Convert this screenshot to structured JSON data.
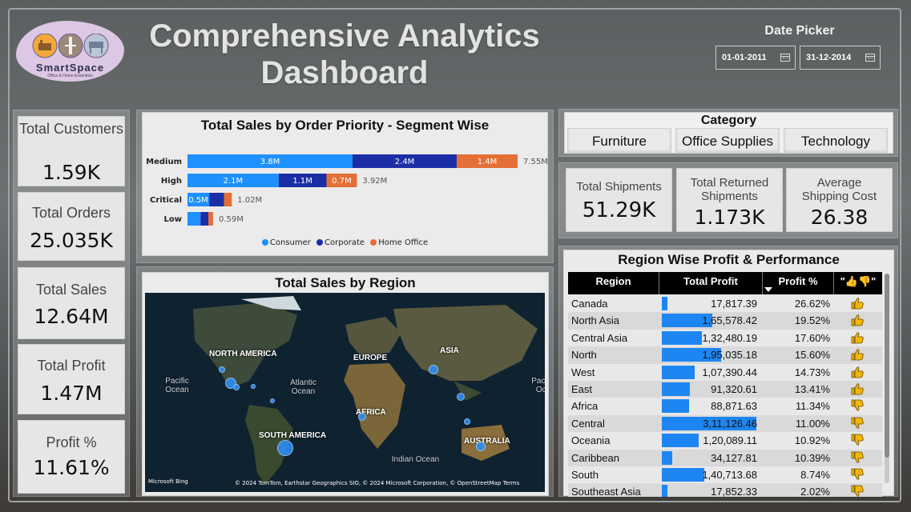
{
  "brand": {
    "name": "SmartSpace",
    "tagline": "Office & Home Essentials"
  },
  "title": "Comprehensive Analytics Dashboard",
  "date_picker": {
    "label": "Date Picker",
    "start": "01-01-2011",
    "end": "31-12-2014"
  },
  "kpis": [
    {
      "label": "Total Customers",
      "value": "1.59K"
    },
    {
      "label": "Total Orders",
      "value": "25.035K"
    },
    {
      "label": "Total Sales",
      "value": "12.64M"
    },
    {
      "label": "Total Profit",
      "value": "1.47M"
    },
    {
      "label": "Profit %",
      "value": "11.61%"
    }
  ],
  "category": {
    "title": "Category",
    "options": [
      "Furniture",
      "Office Supplies",
      "Technology"
    ]
  },
  "shipments": [
    {
      "label": "Total Shipments",
      "value": "51.29K"
    },
    {
      "label": "Total Returned Shipments",
      "value": "1.173K"
    },
    {
      "label": "Average Shipping Cost",
      "value": "26.38"
    }
  ],
  "colors": {
    "consumer": "#1e90ff",
    "corporate": "#1c2ea6",
    "home_office": "#e46f36",
    "bar_profit": "#1e86f2"
  },
  "chart_data": {
    "type": "bar",
    "orientation": "horizontal",
    "stacked": true,
    "title": "Total Sales by Order Priority - Segment Wise",
    "categories": [
      "Medium",
      "High",
      "Critical",
      "Low"
    ],
    "series": [
      {
        "name": "Consumer",
        "values": [
          3.8,
          2.1,
          0.5,
          0.3
        ],
        "labels": [
          "3.8M",
          "2.1M",
          "0.5M",
          ""
        ]
      },
      {
        "name": "Corporate",
        "values": [
          2.4,
          1.1,
          0.34,
          0.18
        ],
        "labels": [
          "2.4M",
          "1.1M",
          "",
          ""
        ]
      },
      {
        "name": "Home Office",
        "values": [
          1.4,
          0.7,
          0.18,
          0.11
        ],
        "labels": [
          "1.4M",
          "0.7M",
          "",
          ""
        ]
      }
    ],
    "totals": [
      "7.55M",
      "3.92M",
      "1.02M",
      "0.59M"
    ],
    "legend": "bottom",
    "grid": false
  },
  "map": {
    "title": "Total Sales by Region",
    "labels": [
      "NORTH AMERICA",
      "EUROPE",
      "ASIA",
      "AFRICA",
      "SOUTH AMERICA",
      "AUSTRALIA"
    ],
    "oceans": [
      "Pacific Ocean",
      "Atlantic Ocean",
      "Indian Ocean",
      "Pacific Oce"
    ],
    "attribution": "© 2024 TomTom, Earthstar Geographics SIO, © 2024 Microsoft Corporation, © OpenStreetMap  Terms",
    "provider": "Microsoft Bing"
  },
  "table": {
    "title": "Region Wise Profit & Performance",
    "headers": [
      "Region",
      "Total Profit",
      "Profit %",
      "\"👍👎\""
    ],
    "rows": [
      {
        "region": "Canada",
        "profit": "17,817.39",
        "pct": "26.62%",
        "profit_value": 17817.39,
        "icon": "thumbs-up"
      },
      {
        "region": "North Asia",
        "profit": "1,65,578.42",
        "pct": "19.52%",
        "profit_value": 165578.42,
        "icon": "thumbs-up"
      },
      {
        "region": "Central Asia",
        "profit": "1,32,480.19",
        "pct": "17.60%",
        "profit_value": 132480.19,
        "icon": "thumbs-up"
      },
      {
        "region": "North",
        "profit": "1,95,035.18",
        "pct": "15.60%",
        "profit_value": 195035.18,
        "icon": "thumbs-up"
      },
      {
        "region": "West",
        "profit": "1,07,390.44",
        "pct": "14.73%",
        "profit_value": 107390.44,
        "icon": "thumbs-up"
      },
      {
        "region": "East",
        "profit": "91,320.61",
        "pct": "13.41%",
        "profit_value": 91320.61,
        "icon": "thumbs-up"
      },
      {
        "region": "Africa",
        "profit": "88,871.63",
        "pct": "11.34%",
        "profit_value": 88871.63,
        "icon": "thumbs-down"
      },
      {
        "region": "Central",
        "profit": "3,11,126.46",
        "pct": "11.00%",
        "profit_value": 311126.46,
        "icon": "thumbs-down"
      },
      {
        "region": "Oceania",
        "profit": "1,20,089.11",
        "pct": "10.92%",
        "profit_value": 120089.11,
        "icon": "thumbs-down"
      },
      {
        "region": "Caribbean",
        "profit": "34,127.81",
        "pct": "10.39%",
        "profit_value": 34127.81,
        "icon": "thumbs-down"
      },
      {
        "region": "South",
        "profit": "1,40,713.68",
        "pct": "8.74%",
        "profit_value": 140713.68,
        "icon": "thumbs-down"
      },
      {
        "region": "Southeast Asia",
        "profit": "17,852.33",
        "pct": "2.02%",
        "profit_value": 17852.33,
        "icon": "thumbs-down"
      }
    ]
  }
}
